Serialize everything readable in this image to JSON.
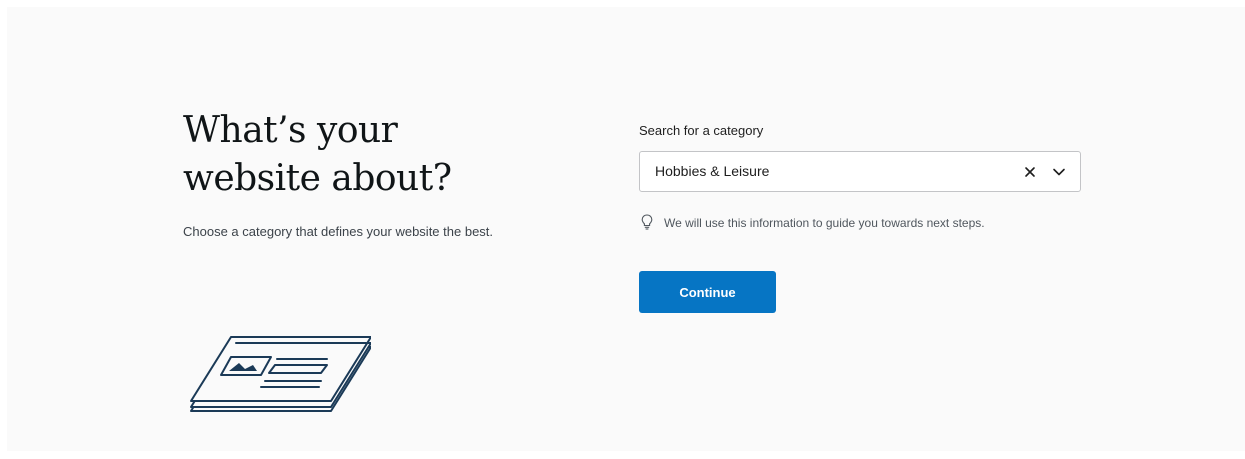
{
  "heading": {
    "line1": "What’s your",
    "line2": "website about?"
  },
  "subtitle": "Choose a category that defines your website the best.",
  "category_field": {
    "label": "Search for a category",
    "selected_value": "Hobbies & Leisure",
    "clear_icon": "close-icon",
    "dropdown_icon": "chevron-down-icon"
  },
  "hint": {
    "icon": "lightbulb-icon",
    "text": "We will use this information to guide you towards next steps."
  },
  "continue_button": {
    "label": "Continue"
  },
  "illustration": {
    "icon": "website-layout-illustration"
  },
  "colors": {
    "background": "#fafafa",
    "primary_button": "#0675c4",
    "illustration_stroke": "#1b3a57",
    "heading_text": "#101517"
  }
}
